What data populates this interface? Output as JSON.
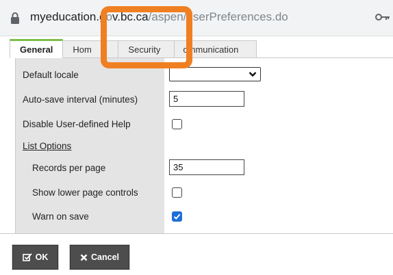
{
  "browser": {
    "url_prefix": "myeducation.g",
    "url_mid": "v.bc.ca",
    "url_path": "/aspen/userPreferences.do"
  },
  "tabs": [
    {
      "label": "General",
      "active": true
    },
    {
      "label": "Home",
      "active": false
    },
    {
      "label": "Security",
      "active": false
    },
    {
      "label": "Communication",
      "active": false
    }
  ],
  "tab_display": {
    "home_visible": "Hom",
    "communication_visible": "ommunication"
  },
  "form": {
    "default_locale_label": "Default locale",
    "default_locale_value": "",
    "autosave_label": "Auto-save interval (minutes)",
    "autosave_value": "5",
    "disable_help_label": "Disable User-defined Help",
    "disable_help_checked": false,
    "list_options_label": "List Options",
    "records_label": "Records per page",
    "records_value": "35",
    "lower_controls_label": "Show lower page controls",
    "lower_controls_checked": false,
    "warn_label": "Warn on save",
    "warn_checked": true
  },
  "buttons": {
    "ok_label": "OK",
    "cancel_label": "Cancel"
  },
  "colors": {
    "highlight": "#f07f22",
    "active_tab_accent": "#7bbf4a",
    "checkbox_checked": "#1d6ed8",
    "button_bg": "#4d4d4d"
  },
  "icons": {
    "lock": "lock-icon",
    "key": "key-icon",
    "chevron": "chevron-down-icon",
    "check": "checkmark-icon",
    "ok": "checkbox-edit-icon",
    "cancel": "close-icon"
  }
}
